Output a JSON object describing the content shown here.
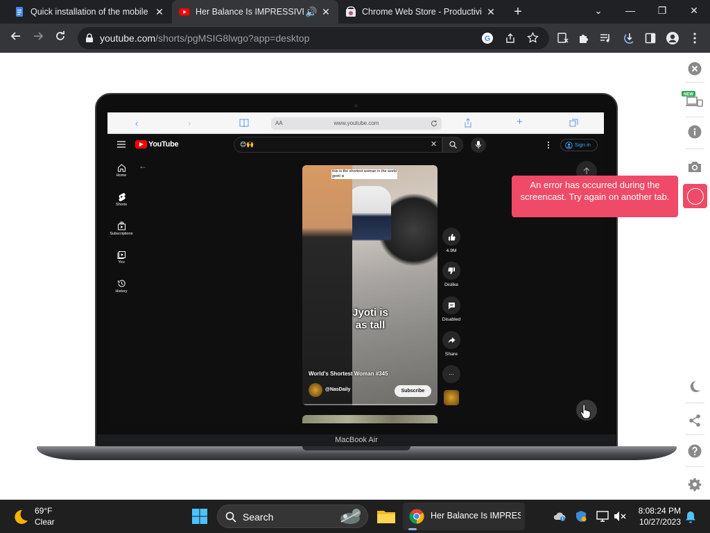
{
  "browser": {
    "tabs": [
      {
        "title": "Quick installation of the mobile a",
        "favicon": "docs-icon",
        "active": false
      },
      {
        "title": "Her Balance Is IMPRESSIVE!🙌",
        "favicon": "youtube-icon",
        "active": true
      },
      {
        "title": "Chrome Web Store - Productivity",
        "favicon": "webstore-icon",
        "active": false
      }
    ],
    "new_tab": "+",
    "address": {
      "host": "youtube.com",
      "path": "/shorts/pgMSIG8lwgo?app=desktop"
    }
  },
  "mockup": {
    "device_label": "MacBook Air",
    "safari": {
      "aa": "AA",
      "url": "www.youtube.com"
    },
    "youtube": {
      "logo_text": "YouTube",
      "search_value": "😊🙌",
      "signin_label": "Sign in",
      "sidebar": [
        {
          "label": "Home",
          "icon": "home-icon"
        },
        {
          "label": "Shorts",
          "icon": "shorts-icon"
        },
        {
          "label": "Subscriptions",
          "icon": "subscriptions-icon"
        },
        {
          "label": "You",
          "icon": "you-icon"
        },
        {
          "label": "History",
          "icon": "history-icon"
        }
      ],
      "short": {
        "top_caption_line1": "this is the shortest woman in the world",
        "top_caption_line2": "geeti is",
        "caption_line1": "Jyoti is",
        "caption_line2": "as tall",
        "title": "World's Shortest Woman #345",
        "channel": "@NasDaily",
        "subscribe_label": "Subscribe"
      },
      "actions": {
        "like_count": "4.9M",
        "dislike_label": "Dislike",
        "comments_label": "Disabled",
        "share_label": "Share",
        "more_label": "···"
      }
    }
  },
  "extension": {
    "new_badge": "NEW",
    "error_message": "An error has occurred during the screencast. Try again on another tab.",
    "accent_color": "#ef4a67"
  },
  "taskbar": {
    "weather_temp": "69°F",
    "weather_condition": "Clear",
    "search_label": "Search",
    "chrome_window_title": "Her Balance Is IMPRESSIVE!",
    "time": "8:08:24 PM",
    "date": "10/27/2023"
  }
}
